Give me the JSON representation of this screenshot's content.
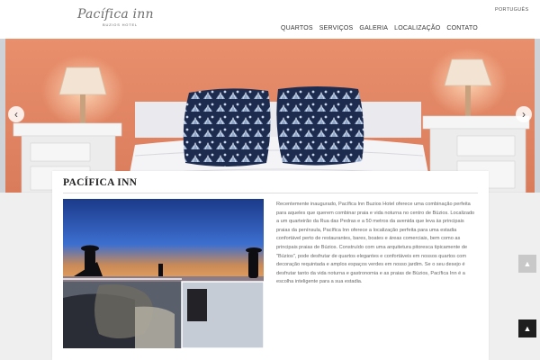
{
  "header": {
    "logo_script": "Pacífica inn",
    "logo_sub": "BUZIOS HOTEL",
    "language": "PORTUGUÊS",
    "nav": [
      "QUARTOS",
      "SERVIÇOS",
      "GALERIA",
      "LOCALIZAÇÃO",
      "CONTATO"
    ]
  },
  "hero": {
    "prev_icon": "chevron-left-icon",
    "next_icon": "chevron-right-icon",
    "prev_glyph": "‹",
    "next_glyph": "›",
    "colors": {
      "wall": "#e98f6c",
      "sheet": "#f5f5f7",
      "nightstand": "#f3f3f3"
    }
  },
  "content": {
    "title": "PACÍFICA INN",
    "description": "Recentemente inaugurado, Pacífica Inn Buzios Hotel oferece uma combinação perfeita para aqueles que querem combinar praia e vida noturna no centro de Búzios. Localizado a um quarteirão da Rua das Pedras e a 50 metros da avenida que leva às principais praias da península, Pacífica Inn oferece a localização perfeita para uma estadia confortável perto de restaurantes, bares, boates e áreas comerciais, bem como as principais praias de Búzios. Construído com uma arquitetura pitoresca tipicamente de \"Búzios\", pode desfrutar de quartos elegantes e confortáveis em nossos quartos com decoração requintada e amplos espaços verdes em nosso jardim. Se o seu desejo é desfrutar tanto da vida noturna e gastronomia e as praias de Búzios, Pacífica Inn é a escolha inteligente para a sua estadia."
  },
  "scroll": {
    "up_icon": "arrow-up-icon",
    "down_icon": "arrow-down-icon",
    "up_glyph": "▲",
    "down_glyph": "▲"
  }
}
